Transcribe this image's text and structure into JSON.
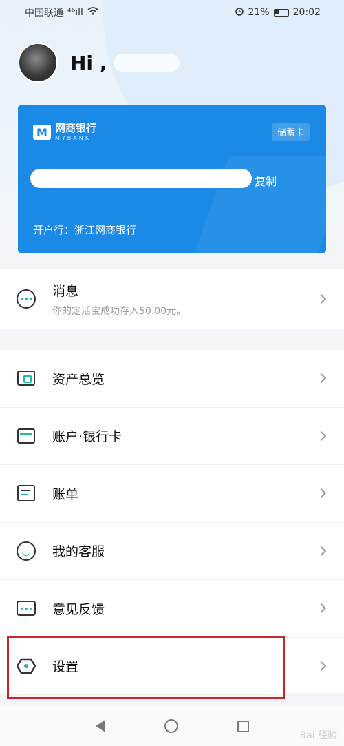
{
  "status_bar": {
    "carrier": "中国联通",
    "signal": "⁴⁶ıll",
    "battery_percent": "21%",
    "time": "20:02"
  },
  "profile": {
    "greeting": "Hi ,"
  },
  "card": {
    "bank_logo_cn": "网商银行",
    "bank_logo_en": "MYBANK",
    "card_type": "储蓄卡",
    "copy_label": "复制",
    "opening_bank": "开户行：浙江网商银行",
    "color": "#1a8ae6"
  },
  "message": {
    "title": "消息",
    "subtitle": "你的定活宝成功存入50.00元。"
  },
  "menu": {
    "items": [
      {
        "label": "资产总览",
        "icon": "wallet-icon"
      },
      {
        "label": "账户·银行卡",
        "icon": "card-icon"
      },
      {
        "label": "账单",
        "icon": "bill-icon"
      },
      {
        "label": "我的客服",
        "icon": "service-icon"
      },
      {
        "label": "意见反馈",
        "icon": "feedback-icon"
      },
      {
        "label": "设置",
        "icon": "settings-icon"
      }
    ]
  },
  "highlight_color": "#c8262b",
  "watermark": "Bai 经验"
}
